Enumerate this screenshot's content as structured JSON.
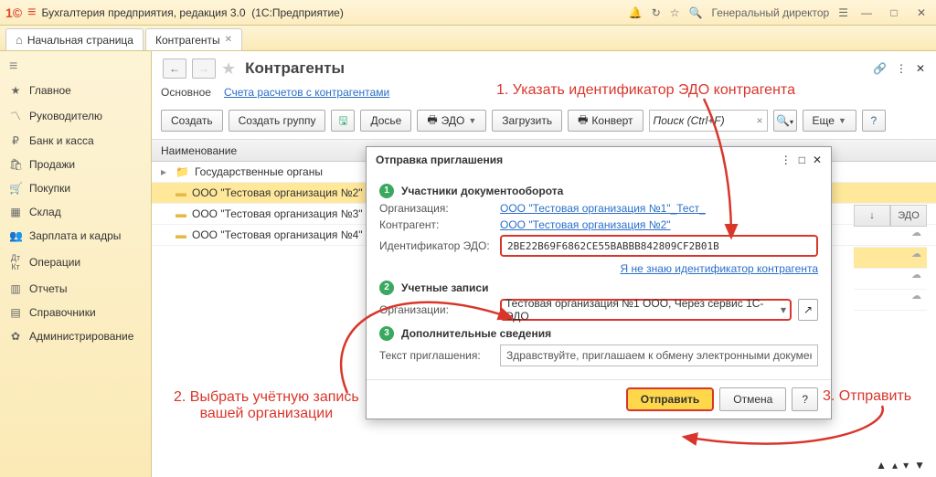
{
  "titlebar": {
    "app": "Бухгалтерия предприятия, редакция 3.0",
    "suffix": "(1С:Предприятие)",
    "user": "Генеральный директор"
  },
  "tabs": {
    "home": "Начальная страница",
    "active": "Контрагенты"
  },
  "sidebar": {
    "items": [
      {
        "icon": "≡",
        "label": ""
      },
      {
        "icon": "★",
        "label": "Главное"
      },
      {
        "icon": "📈",
        "label": "Руководителю"
      },
      {
        "icon": "₽",
        "label": "Банк и касса"
      },
      {
        "icon": "🛍",
        "label": "Продажи"
      },
      {
        "icon": "🛒",
        "label": "Покупки"
      },
      {
        "icon": "📦",
        "label": "Склад"
      },
      {
        "icon": "👥",
        "label": "Зарплата и кадры"
      },
      {
        "icon": "Дт",
        "label": "Операции"
      },
      {
        "icon": "📊",
        "label": "Отчеты"
      },
      {
        "icon": "📚",
        "label": "Справочники"
      },
      {
        "icon": "⚙",
        "label": "Администрирование"
      }
    ]
  },
  "page": {
    "title": "Контрагенты",
    "sub_main": "Основное",
    "sub_link": "Счета расчетов с контрагентами"
  },
  "toolbar": {
    "create": "Создать",
    "create_group": "Создать группу",
    "dossier": "Досье",
    "edo": "ЭДО",
    "load": "Загрузить",
    "convert": "Конверт",
    "search_ph": "Поиск (Ctrl+F)",
    "more": "Еще"
  },
  "grid": {
    "header": "Наименование",
    "rows": [
      {
        "type": "folder",
        "name": "Государственные органы"
      },
      {
        "type": "item",
        "name": "ООО \"Тестовая организация №2\"",
        "sel": true
      },
      {
        "type": "item",
        "name": "ООО \"Тестовая организация №3\""
      },
      {
        "type": "item",
        "name": "ООО \"Тестовая организация №4\""
      }
    ],
    "right_cols": {
      "arrow": "↓",
      "edo": "ЭДО"
    }
  },
  "dialog": {
    "title": "Отправка приглашения",
    "step1": "Участники документооборота",
    "org_label": "Организация:",
    "org_link": "ООО \"Тестовая организация №1\"_Тест_",
    "ctr_label": "Контрагент:",
    "ctr_link": "ООО \"Тестовая организация №2\"",
    "id_label": "Идентификатор ЭДО:",
    "id_value": "2BE22B69F6862CE55BABBB842809CF2B01B",
    "noid": "Я не знаю идентификатор контрагента",
    "step2": "Учетные записи",
    "acct_label": "Организации:",
    "acct_value": "Тестовая организация №1 ООО, Через сервис 1С-ЭДО",
    "step3": "Дополнительные сведения",
    "text_label": "Текст приглашения:",
    "text_value": "Здравствуйте, приглашаем к обмену электронными документами.",
    "send": "Отправить",
    "cancel": "Отмена",
    "help": "?"
  },
  "callouts": {
    "c1": "1. Указать идентификатор ЭДО контрагента",
    "c2": "2. Выбрать учётную запись\nвашей организации",
    "c3": "3. Отправить"
  }
}
